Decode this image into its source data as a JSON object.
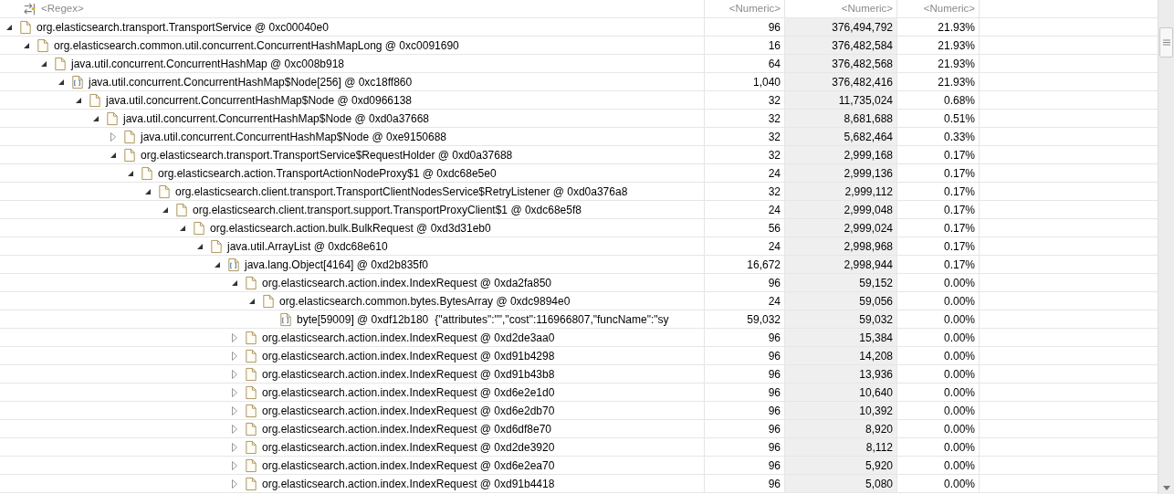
{
  "filter_row": [
    {
      "placeholder": "<Regex>",
      "shaded": false
    },
    {
      "placeholder": "<Numeric>",
      "shaded": false
    },
    {
      "placeholder": "<Numeric>",
      "shaded": true
    },
    {
      "placeholder": "<Numeric>",
      "shaded": false
    }
  ],
  "rows": [
    {
      "label": "org.elasticsearch.transport.TransportService @ 0xc00040e0",
      "kind": "object",
      "expanded": true,
      "column_2": "96",
      "column_3": "376,494,792",
      "column_4": "21.93%",
      "children": [
        {
          "label": "org.elasticsearch.common.util.concurrent.ConcurrentHashMapLong @ 0xc0091690",
          "kind": "object",
          "expanded": true,
          "column_2": "16",
          "column_3": "376,482,584",
          "column_4": "21.93%",
          "children": [
            {
              "label": "java.util.concurrent.ConcurrentHashMap @ 0xc008b918",
              "kind": "object",
              "expanded": true,
              "column_2": "64",
              "column_3": "376,482,568",
              "column_4": "21.93%",
              "children": [
                {
                  "label": "java.util.concurrent.ConcurrentHashMap$Node[256] @ 0xc18ff860",
                  "kind": "array",
                  "expanded": true,
                  "column_2": "1,040",
                  "column_3": "376,482,416",
                  "column_4": "21.93%",
                  "children": [
                    {
                      "label": "java.util.concurrent.ConcurrentHashMap$Node @ 0xd0966138",
                      "kind": "object",
                      "expanded": true,
                      "column_2": "32",
                      "column_3": "11,735,024",
                      "column_4": "0.68%",
                      "children": [
                        {
                          "label": "java.util.concurrent.ConcurrentHashMap$Node @ 0xd0a37668",
                          "kind": "object",
                          "expanded": true,
                          "column_2": "32",
                          "column_3": "8,681,688",
                          "column_4": "0.51%",
                          "children": [
                            {
                              "label": "java.util.concurrent.ConcurrentHashMap$Node @ 0xe9150688",
                              "kind": "object",
                              "expanded": false,
                              "column_2": "32",
                              "column_3": "5,682,464",
                              "column_4": "0.33%"
                            },
                            {
                              "label": "org.elasticsearch.transport.TransportService$RequestHolder @ 0xd0a37688",
                              "kind": "object",
                              "expanded": true,
                              "column_2": "32",
                              "column_3": "2,999,168",
                              "column_4": "0.17%",
                              "children": [
                                {
                                  "label": "org.elasticsearch.action.TransportActionNodeProxy$1 @ 0xdc68e5e0",
                                  "kind": "object",
                                  "expanded": true,
                                  "column_2": "24",
                                  "column_3": "2,999,136",
                                  "column_4": "0.17%",
                                  "children": [
                                    {
                                      "label": "org.elasticsearch.client.transport.TransportClientNodesService$RetryListener @ 0xd0a376a8",
                                      "kind": "object",
                                      "expanded": true,
                                      "column_2": "32",
                                      "column_3": "2,999,112",
                                      "column_4": "0.17%",
                                      "children": [
                                        {
                                          "label": "org.elasticsearch.client.transport.support.TransportProxyClient$1 @ 0xdc68e5f8",
                                          "kind": "object",
                                          "expanded": true,
                                          "column_2": "24",
                                          "column_3": "2,999,048",
                                          "column_4": "0.17%",
                                          "children": [
                                            {
                                              "label": "org.elasticsearch.action.bulk.BulkRequest @ 0xd3d31eb0",
                                              "kind": "object",
                                              "expanded": true,
                                              "column_2": "56",
                                              "column_3": "2,999,024",
                                              "column_4": "0.17%",
                                              "children": [
                                                {
                                                  "label": "java.util.ArrayList @ 0xdc68e610",
                                                  "kind": "object",
                                                  "expanded": true,
                                                  "column_2": "24",
                                                  "column_3": "2,998,968",
                                                  "column_4": "0.17%",
                                                  "children": [
                                                    {
                                                      "label": "java.lang.Object[4164] @ 0xd2b835f0",
                                                      "kind": "array",
                                                      "expanded": true,
                                                      "column_2": "16,672",
                                                      "column_3": "2,998,944",
                                                      "column_4": "0.17%",
                                                      "children": [
                                                        {
                                                          "label": "org.elasticsearch.action.index.IndexRequest @ 0xda2fa850",
                                                          "kind": "object",
                                                          "expanded": true,
                                                          "column_2": "96",
                                                          "column_3": "59,152",
                                                          "column_4": "0.00%",
                                                          "children": [
                                                            {
                                                              "label": "org.elasticsearch.common.bytes.BytesArray @ 0xdc9894e0",
                                                              "kind": "object",
                                                              "expanded": true,
                                                              "column_2": "24",
                                                              "column_3": "59,056",
                                                              "column_4": "0.00%",
                                                              "children": [
                                                                {
                                                                  "label": "byte[59009] @ 0xdf12b180",
                                                                  "preview": "{\"attributes\":\"\",\"cost\":116966807,\"funcName\":\"sy",
                                                                  "kind": "array",
                                                                  "column_2": "59,032",
                                                                  "column_3": "59,032",
                                                                  "column_4": "0.00%"
                                                                }
                                                              ]
                                                            }
                                                          ]
                                                        },
                                                        {
                                                          "label": "org.elasticsearch.action.index.IndexRequest @ 0xd2de3aa0",
                                                          "kind": "object",
                                                          "expanded": false,
                                                          "column_2": "96",
                                                          "column_3": "15,384",
                                                          "column_4": "0.00%"
                                                        },
                                                        {
                                                          "label": "org.elasticsearch.action.index.IndexRequest @ 0xd91b4298",
                                                          "kind": "object",
                                                          "expanded": false,
                                                          "column_2": "96",
                                                          "column_3": "14,208",
                                                          "column_4": "0.00%"
                                                        },
                                                        {
                                                          "label": "org.elasticsearch.action.index.IndexRequest @ 0xd91b43b8",
                                                          "kind": "object",
                                                          "expanded": false,
                                                          "column_2": "96",
                                                          "column_3": "13,936",
                                                          "column_4": "0.00%"
                                                        },
                                                        {
                                                          "label": "org.elasticsearch.action.index.IndexRequest @ 0xd6e2e1d0",
                                                          "kind": "object",
                                                          "expanded": false,
                                                          "column_2": "96",
                                                          "column_3": "10,640",
                                                          "column_4": "0.00%"
                                                        },
                                                        {
                                                          "label": "org.elasticsearch.action.index.IndexRequest @ 0xd6e2db70",
                                                          "kind": "object",
                                                          "expanded": false,
                                                          "column_2": "96",
                                                          "column_3": "10,392",
                                                          "column_4": "0.00%"
                                                        },
                                                        {
                                                          "label": "org.elasticsearch.action.index.IndexRequest @ 0xd6df8e70",
                                                          "kind": "object",
                                                          "expanded": false,
                                                          "column_2": "96",
                                                          "column_3": "8,920",
                                                          "column_4": "0.00%"
                                                        },
                                                        {
                                                          "label": "org.elasticsearch.action.index.IndexRequest @ 0xd2de3920",
                                                          "kind": "object",
                                                          "expanded": false,
                                                          "column_2": "96",
                                                          "column_3": "8,112",
                                                          "column_4": "0.00%"
                                                        },
                                                        {
                                                          "label": "org.elasticsearch.action.index.IndexRequest @ 0xd6e2ea70",
                                                          "kind": "object",
                                                          "expanded": false,
                                                          "column_2": "96",
                                                          "column_3": "5,920",
                                                          "column_4": "0.00%"
                                                        },
                                                        {
                                                          "label": "org.elasticsearch.action.index.IndexRequest @ 0xd91b4418",
                                                          "kind": "object",
                                                          "expanded": false,
                                                          "column_2": "96",
                                                          "column_3": "5,080",
                                                          "column_4": "0.00%"
                                                        }
                                                      ]
                                                    }
                                                  ]
                                                }
                                              ]
                                            }
                                          ]
                                        }
                                      ]
                                    }
                                  ]
                                }
                              ]
                            }
                          ]
                        }
                      ]
                    }
                  ]
                }
              ]
            }
          ]
        }
      ]
    }
  ]
}
